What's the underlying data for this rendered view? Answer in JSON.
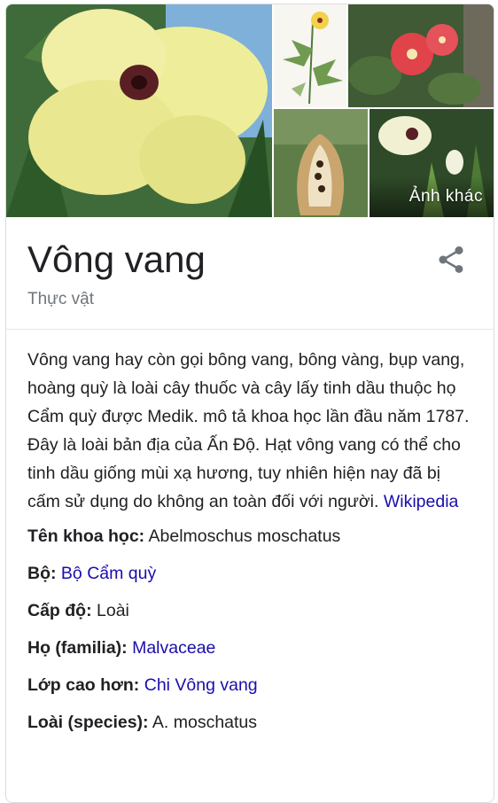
{
  "gallery": {
    "more_photos_label": "Ảnh khác"
  },
  "header": {
    "title": "Vông vang",
    "subtitle": "Thực vật",
    "share_icon": "share-icon"
  },
  "description": {
    "text": "Vông vang hay còn gọi bông vang, bông vàng, bụp vang, hoàng quỳ là loài cây thuốc và cây lấy tinh dầu thuộc họ Cẩm quỳ được Medik. mô tả khoa học lần đầu năm 1787. Đây là loài bản địa của Ấn Độ. Hạt vông vang có thể cho tinh dầu giống mùi xạ hương, tuy nhiên hiện nay đã bị cấm sử dụng do không an toàn đối với người.",
    "source_link": "Wikipedia"
  },
  "attributes": [
    {
      "label": "Tên khoa học:",
      "value": "Abelmoschus moschatus",
      "is_link": false
    },
    {
      "label": "Bộ:",
      "value": "Bộ Cẩm quỳ",
      "is_link": true
    },
    {
      "label": "Cấp độ:",
      "value": "Loài",
      "is_link": false
    },
    {
      "label": "Họ (familia):",
      "value": "Malvaceae",
      "is_link": true
    },
    {
      "label": "Lớp cao hơn:",
      "value": "Chi Vông vang",
      "is_link": true
    },
    {
      "label": "Loài (species):",
      "value": "A. moschatus",
      "is_link": false
    }
  ],
  "colors": {
    "link": "#1a0dab",
    "subtitle": "#70757a",
    "text": "#202124"
  }
}
